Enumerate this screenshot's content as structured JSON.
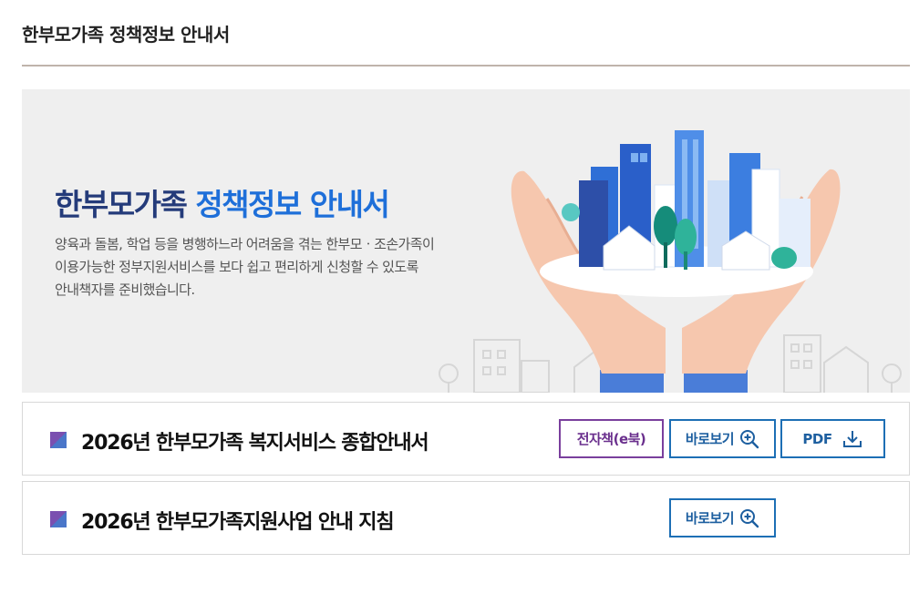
{
  "page": {
    "title": "한부모가족 정책정보 안내서"
  },
  "banner": {
    "heading_plain": "한부모가족",
    "heading_accent": "정책정보 안내서",
    "description": [
      "양육과 돌봄, 학업 등을 병행하느라 어려움을 겪는 한부모ㆍ조손가족이",
      "이용가능한 정부지원서비스를 보다 쉽고 편리하게 신청할 수 있도록",
      "안내책자를 준비했습니다."
    ]
  },
  "items": [
    {
      "title": "2026년 한부모가족 복지서비스 종합안내서",
      "buttons": {
        "ebook": "전자책(e북)",
        "view": "바로보기",
        "pdf": "PDF"
      }
    },
    {
      "title": "2026년 한부모가족지원사업 안내 지침",
      "buttons": {
        "view": "바로보기"
      }
    }
  ],
  "icons": {
    "zoom": "zoom-in-icon",
    "download": "download-icon",
    "bullet": "square-bullet-icon"
  },
  "colors": {
    "heading_accent": "#1e6fd9",
    "heading_plain": "#243b7a",
    "ebook_border": "#7a3f9d",
    "view_border": "#1d6fb5",
    "rule": "#bfb4ab",
    "banner_bg": "#efefef"
  }
}
